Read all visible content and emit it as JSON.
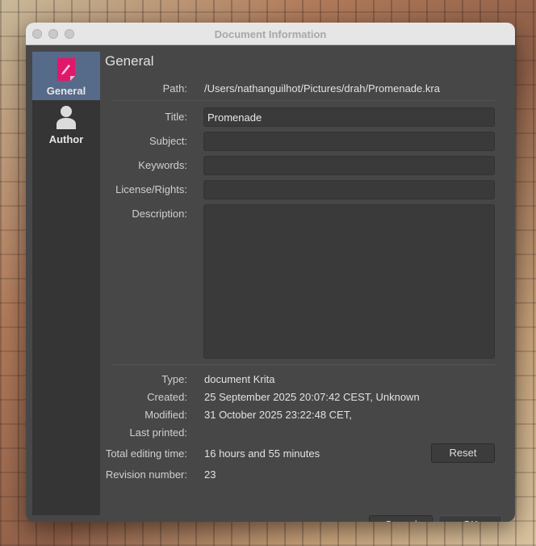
{
  "window": {
    "title": "Document Information"
  },
  "sidebar": {
    "items": [
      {
        "label": "General",
        "icon": "document-pen-icon"
      },
      {
        "label": "Author",
        "icon": "person-icon"
      }
    ]
  },
  "page": {
    "heading": "General"
  },
  "path": {
    "label": "Path:",
    "value": "/Users/nathanguilhot/Pictures/drah/Promenade.kra"
  },
  "fields": {
    "title": {
      "label": "Title:",
      "value": "Promenade"
    },
    "subject": {
      "label": "Subject:",
      "value": ""
    },
    "keywords": {
      "label": "Keywords:",
      "value": ""
    },
    "license": {
      "label": "License/Rights:",
      "value": ""
    },
    "description": {
      "label": "Description:",
      "value": ""
    }
  },
  "info": {
    "type": {
      "label": "Type:",
      "value": "document Krita"
    },
    "created": {
      "label": "Created:",
      "value": "25 September 2025 20:07:42 CEST, Unknown"
    },
    "modified": {
      "label": "Modified:",
      "value": "31 October 2025 23:22:48 CET,"
    },
    "printed": {
      "label": "Last printed:",
      "value": ""
    },
    "editing": {
      "label": "Total editing time:",
      "value": "16 hours and 55 minutes"
    },
    "revision": {
      "label": "Revision number:",
      "value": "23"
    }
  },
  "buttons": {
    "reset": "Reset",
    "cancel": "Cancel",
    "ok": "OK"
  },
  "colors": {
    "accent": "#566a8a",
    "icon_pink": "#e0186c"
  }
}
